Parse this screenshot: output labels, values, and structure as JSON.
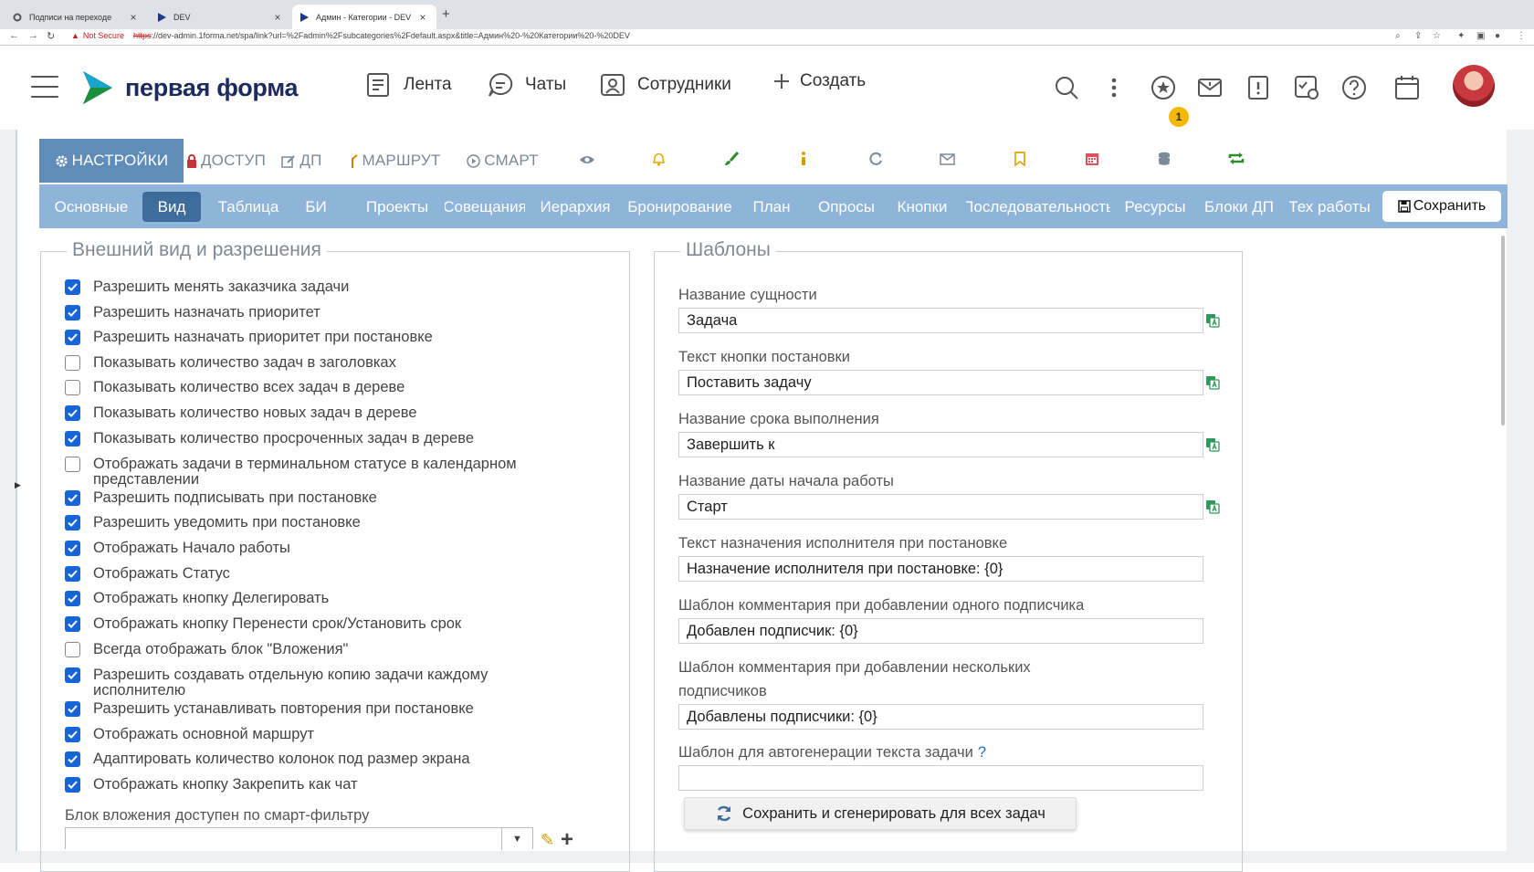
{
  "browser": {
    "tabs": [
      {
        "title": "Подписи на переходе",
        "icon": "gear-favicon-icon"
      },
      {
        "title": "DEV",
        "icon": "play-favicon-icon"
      },
      {
        "title": "Админ - Категории - DEV",
        "icon": "play-favicon-icon"
      }
    ],
    "security_label": "Not Secure",
    "url_scheme": "https",
    "url_rest": "://dev-admin.1forma.net/spa/link?url=%2Fadmin%2Fsubcategories%2Fdefault.aspx&title=Админ%20-%20Категории%20-%20DEV"
  },
  "app": {
    "logo_text": "первая форма",
    "nav": [
      {
        "label": "Лента",
        "icon": "feed-icon"
      },
      {
        "label": "Чаты",
        "icon": "chat-icon"
      },
      {
        "label": "Сотрудники",
        "icon": "employees-icon"
      },
      {
        "label": "Создать",
        "icon": "plus-icon"
      }
    ],
    "notification_count": "1"
  },
  "icon_tabs": [
    {
      "label": "НАСТРОЙКИ",
      "icon": "gear-icon"
    },
    {
      "label": "ДОСТУП",
      "icon": "lock-icon"
    },
    {
      "label": "ДП",
      "icon": "edit-icon"
    },
    {
      "label": "МАРШРУТ",
      "icon": "route-icon"
    },
    {
      "label": "СМАРТ",
      "icon": "play-circle-icon"
    },
    {
      "label": "",
      "icon": "eye-icon"
    },
    {
      "label": "",
      "icon": "bell-icon"
    },
    {
      "label": "",
      "icon": "brush-icon"
    },
    {
      "label": "",
      "icon": "info-icon"
    },
    {
      "label": "",
      "icon": "refresh-icon"
    },
    {
      "label": "",
      "icon": "envelope-icon"
    },
    {
      "label": "",
      "icon": "bookmark-icon"
    },
    {
      "label": "",
      "icon": "calendar-icon"
    },
    {
      "label": "",
      "icon": "database-icon"
    },
    {
      "label": "",
      "icon": "sync-icon"
    }
  ],
  "sub_tabs": [
    {
      "label": "Основные"
    },
    {
      "label": "Вид"
    },
    {
      "label": "Таблица"
    },
    {
      "label": "БИ"
    },
    {
      "label": "Проекты"
    },
    {
      "label": "Совещания"
    },
    {
      "label": "Иерархия"
    },
    {
      "label": "Бронирование"
    },
    {
      "label": "План"
    },
    {
      "label": "Опросы"
    },
    {
      "label": "Кнопки"
    },
    {
      "label": "Последовательность"
    },
    {
      "label": "Ресурсы"
    },
    {
      "label": "Блоки ДП"
    },
    {
      "label": "Тех работы"
    }
  ],
  "save_label": "Сохранить",
  "left_section": {
    "title": "Внешний вид и разрешения",
    "checkboxes": [
      {
        "label": "Разрешить менять заказчика задачи",
        "checked": true
      },
      {
        "label": "Разрешить назначать приоритет",
        "checked": true
      },
      {
        "label": "Разрешить назначать приоритет при постановке",
        "checked": true
      },
      {
        "label": "Показывать количество задач в заголовках",
        "checked": false
      },
      {
        "label": "Показывать количество всех задач в дереве",
        "checked": false
      },
      {
        "label": "Показывать количество новых задач в дереве",
        "checked": true
      },
      {
        "label": "Показывать количество просроченных задач в дереве",
        "checked": true
      },
      {
        "label": "Отображать задачи в терминальном статусе в календарном представлении",
        "checked": false
      },
      {
        "label": "Разрешить подписывать при постановке",
        "checked": true
      },
      {
        "label": "Разрешить уведомить при постановке",
        "checked": true
      },
      {
        "label": "Отображать Начало работы",
        "checked": true
      },
      {
        "label": "Отображать Статус",
        "checked": true
      },
      {
        "label": "Отображать кнопку Делегировать",
        "checked": true
      },
      {
        "label": "Отображать кнопку Перенести срок/Установить срок",
        "checked": true
      },
      {
        "label": "Всегда отображать блок \"Вложения\"",
        "checked": false
      },
      {
        "label": "Разрешить создавать отдельную копию задачи каждому исполнителю",
        "checked": true
      },
      {
        "label": "Разрешить устанавливать повторения при постановке",
        "checked": true
      },
      {
        "label": "Отображать основной маршрут",
        "checked": true
      },
      {
        "label": "Адаптировать количество колонок под размер экрана",
        "checked": true
      },
      {
        "label": "Отображать кнопку Закрепить как чат",
        "checked": true
      }
    ],
    "attachment_block_label": "Блок вложения доступен по смарт-фильтру",
    "attachment_block_value": ""
  },
  "right_section": {
    "title": "Шаблоны",
    "fields": [
      {
        "label": "Название сущности",
        "value": "Задача",
        "translate": true
      },
      {
        "label": "Текст кнопки постановки",
        "value": "Поставить задачу",
        "translate": true
      },
      {
        "label": "Название срока выполнения",
        "value": "Завершить к",
        "translate": true
      },
      {
        "label": "Название даты начала работы",
        "value": "Старт",
        "translate": true
      },
      {
        "label": "Текст назначения исполнителя при постановке",
        "value": "Назначение исполнителя при постановке: {0}",
        "translate": false
      },
      {
        "label": "Шаблон комментария при добавлении одного подписчика",
        "value": "Добавлен подписчик: {0}",
        "translate": false
      },
      {
        "label": "Шаблон комментария при добавлении нескольких подписчиков",
        "value": "Добавлены подписчики: {0}",
        "translate": false
      },
      {
        "label": "Шаблон для автогенерации текста задачи",
        "value": "",
        "translate": false,
        "help": "?"
      }
    ],
    "generate_button": "Сохранить и сгенерировать для всех задач"
  }
}
